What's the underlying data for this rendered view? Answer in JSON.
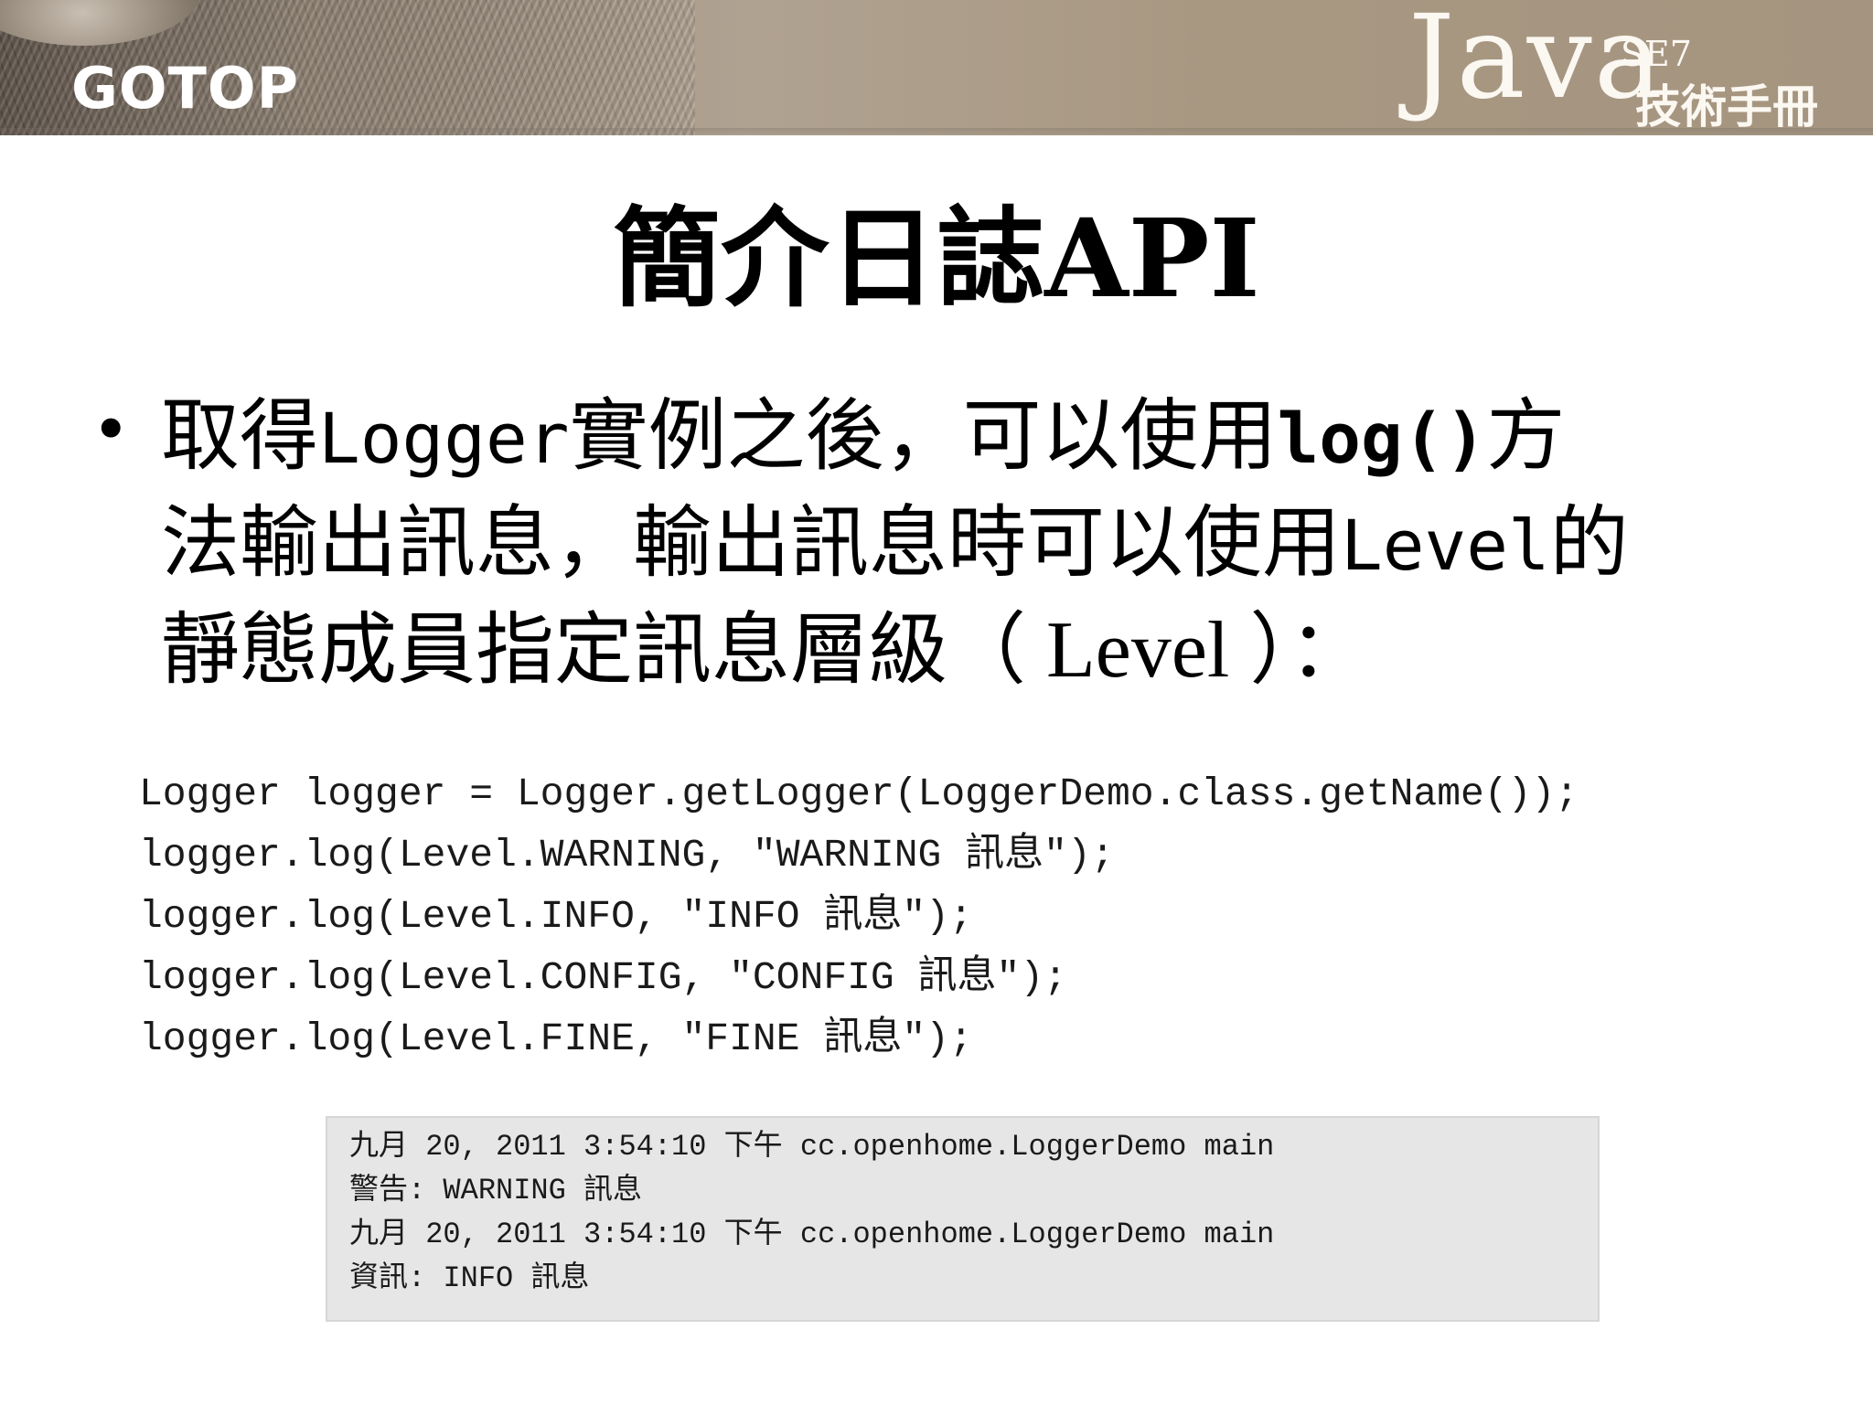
{
  "header": {
    "brand": "GOTOP",
    "book_logo": {
      "word": "Java",
      "edition": "SE7",
      "subtitle": "技術手冊"
    }
  },
  "slide": {
    "title": "簡介日誌API",
    "bullet": {
      "line1": {
        "a": "取得",
        "b": "Logger",
        "c": "實例之後，可以使用",
        "d": "log()",
        "e": "方"
      },
      "line2": {
        "a": "法輸出訊息，輸出訊息時可以使用",
        "b": "Level",
        "c": "的"
      },
      "line3": {
        "a": "靜態成員指定訊息層級（",
        "b": " Level ",
        "c": "）："
      }
    },
    "code_lines": [
      "Logger logger = Logger.getLogger(LoggerDemo.class.getName());",
      "logger.log(Level.WARNING, \"WARNING 訊息\");",
      "logger.log(Level.INFO, \"INFO 訊息\");",
      "logger.log(Level.CONFIG, \"CONFIG 訊息\");",
      "logger.log(Level.FINE, \"FINE 訊息\");"
    ],
    "console_lines": [
      "九月 20, 2011 3:54:10 下午 cc.openhome.LoggerDemo main",
      "警告: WARNING 訊息",
      "九月 20, 2011 3:54:10 下午 cc.openhome.LoggerDemo main",
      "資訊: INFO 訊息"
    ]
  }
}
